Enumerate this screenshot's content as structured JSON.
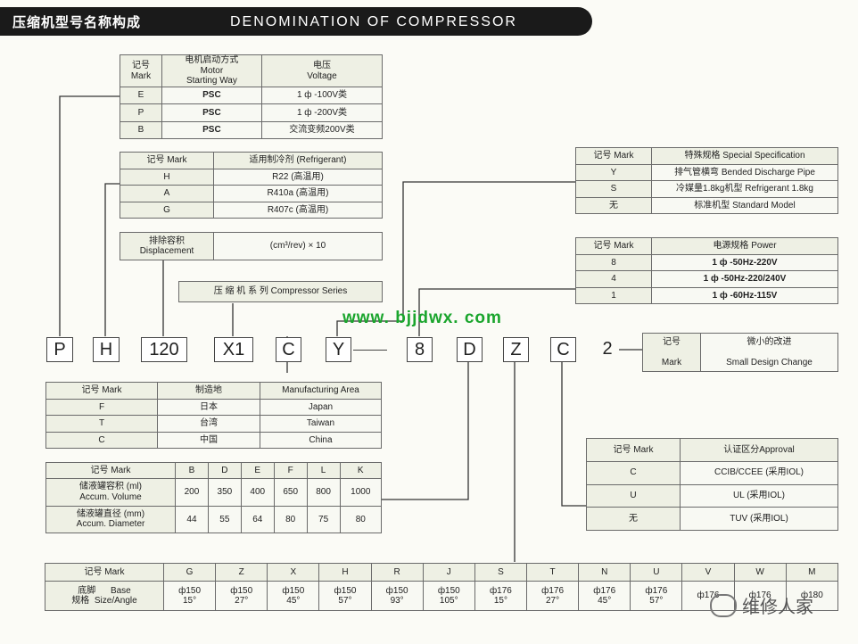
{
  "header": {
    "title_cn": "压缩机型号名称构成",
    "title_en": "DENOMINATION OF COMPRESSOR"
  },
  "watermark_url": "www. bjjdwx. com",
  "watermark_brand": "维修人家",
  "model_boxes": [
    "P",
    "H",
    "120",
    "X1",
    "C",
    "Y",
    "8",
    "D",
    "Z",
    "C",
    "2"
  ],
  "motor_table": {
    "headers": [
      [
        "记号",
        "Mark"
      ],
      [
        "电机启动方式",
        "Motor",
        "Starting  Way"
      ],
      [
        "电压",
        "Voltage"
      ]
    ],
    "rows": [
      [
        "E",
        "PSC",
        "1 ф -100V类"
      ],
      [
        "P",
        "PSC",
        "1 ф -200V类"
      ],
      [
        "B",
        "PSC",
        "交流变频200V类"
      ]
    ]
  },
  "refrigerant_table": {
    "headers": [
      "记号   Mark",
      "适用制冷剂  (Refrigerant)"
    ],
    "rows": [
      [
        "H",
        "R22   (高温用)"
      ],
      [
        "A",
        "R410a (高温用)"
      ],
      [
        "G",
        "R407c (高温用)"
      ]
    ]
  },
  "displacement": {
    "label_cn": "排除容积",
    "label_en": "Displacement",
    "unit": "(cm³/rev)   ×   10"
  },
  "series": {
    "label": "压 缩 机  系  列     Compressor  Series"
  },
  "special_table": {
    "headers": [
      "记号    Mark",
      "特殊规格   Special Specification"
    ],
    "rows": [
      [
        "Y",
        "排气管横弯  Bended  Discharge Pipe"
      ],
      [
        "S",
        "冷媒量1.8kg机型  Refrigerant 1.8kg"
      ],
      [
        "无",
        "标准机型        Standard Model"
      ]
    ]
  },
  "power_table": {
    "headers": [
      "记号    Mark",
      "电源规格              Power"
    ],
    "rows": [
      [
        "8",
        "1 ф -50Hz-220V"
      ],
      [
        "4",
        "1 ф -50Hz-220/240V"
      ],
      [
        "1",
        "1 ф -60Hz-115V"
      ]
    ]
  },
  "design_change": {
    "mark_cn": "记号",
    "mark_en": "Mark",
    "text_cn": "微小的改进",
    "text_en": "Small Design Change"
  },
  "area_table": {
    "headers": [
      "记号    Mark",
      "制造地",
      "Manufacturing Area"
    ],
    "rows": [
      [
        "F",
        "日本",
        "Japan"
      ],
      [
        "T",
        "台湾",
        "Taiwan"
      ],
      [
        "C",
        "中国",
        "China"
      ]
    ]
  },
  "accum_table": {
    "mark_header": "记号             Mark",
    "marks": [
      "B",
      "D",
      "E",
      "F",
      "L",
      "K"
    ],
    "rows": [
      {
        "label_cn": "储液罐容积 (ml)",
        "label_en": "Accum. Volume",
        "values": [
          "200",
          "350",
          "400",
          "650",
          "800",
          "1000"
        ]
      },
      {
        "label_cn": "储液罐直径 (mm)",
        "label_en": "Accum. Diameter",
        "values": [
          "44",
          "55",
          "64",
          "80",
          "75",
          "80"
        ]
      }
    ]
  },
  "approval_table": {
    "headers": [
      "记号    Mark",
      "认证区分Approval"
    ],
    "rows": [
      [
        "C",
        "CCIB/CCEE  (采用IOL)"
      ],
      [
        "U",
        "UL (采用IOL)"
      ],
      [
        "无",
        "TUV  (采用IOL)"
      ]
    ]
  },
  "base_table": {
    "mark_header": "记号           Mark",
    "label_cn1": "底脚",
    "label_en1": "Base",
    "label_cn2": "规格",
    "label_en2": "Size/Angle",
    "marks": [
      "G",
      "Z",
      "X",
      "H",
      "R",
      "J",
      "S",
      "T",
      "N",
      "U",
      "V",
      "W",
      "M"
    ],
    "sizes": [
      "ф150",
      "ф150",
      "ф150",
      "ф150",
      "ф150",
      "ф150",
      "ф176",
      "ф176",
      "ф176",
      "ф176",
      "ф176",
      "ф176",
      "ф180"
    ],
    "angles": [
      "15°",
      "27°",
      "45°",
      "57°",
      "93°",
      "105°",
      "15°",
      "27°",
      "45°",
      "57°",
      "",
      "",
      ""
    ]
  }
}
